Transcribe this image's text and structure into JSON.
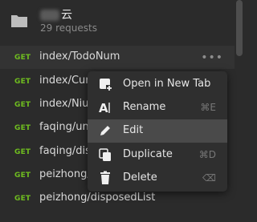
{
  "collection": {
    "name_suffix": "云",
    "count": "29 requests"
  },
  "requests": [
    {
      "method": "GET",
      "url": "index/TodoNum",
      "more": "•••"
    },
    {
      "method": "GET",
      "url": "index/CurN"
    },
    {
      "method": "GET",
      "url": "index/Niuc"
    },
    {
      "method": "GET",
      "url": "faqing/unD"
    },
    {
      "method": "GET",
      "url": "faqing/disp"
    },
    {
      "method": "GET",
      "url": "peizhong/u"
    },
    {
      "method": "GET",
      "url": "peizhong/disposedList"
    }
  ],
  "context_menu": {
    "items": [
      {
        "label": "Open in New Tab",
        "shortcut": "",
        "icon": "open-new-tab-icon"
      },
      {
        "label": "Rename",
        "shortcut": "⌘E",
        "icon": "rename-icon"
      },
      {
        "label": "Edit",
        "shortcut": "",
        "icon": "edit-pencil-icon"
      },
      {
        "label": "Duplicate",
        "shortcut": "⌘D",
        "icon": "duplicate-icon"
      },
      {
        "label": "Delete",
        "shortcut": "⌫",
        "icon": "trash-icon"
      }
    ],
    "highlighted_index": 2
  },
  "colors": {
    "background": "#2b2b2b",
    "method_get": "#6fbd1f",
    "menu_highlight": "#4a4a4a"
  }
}
